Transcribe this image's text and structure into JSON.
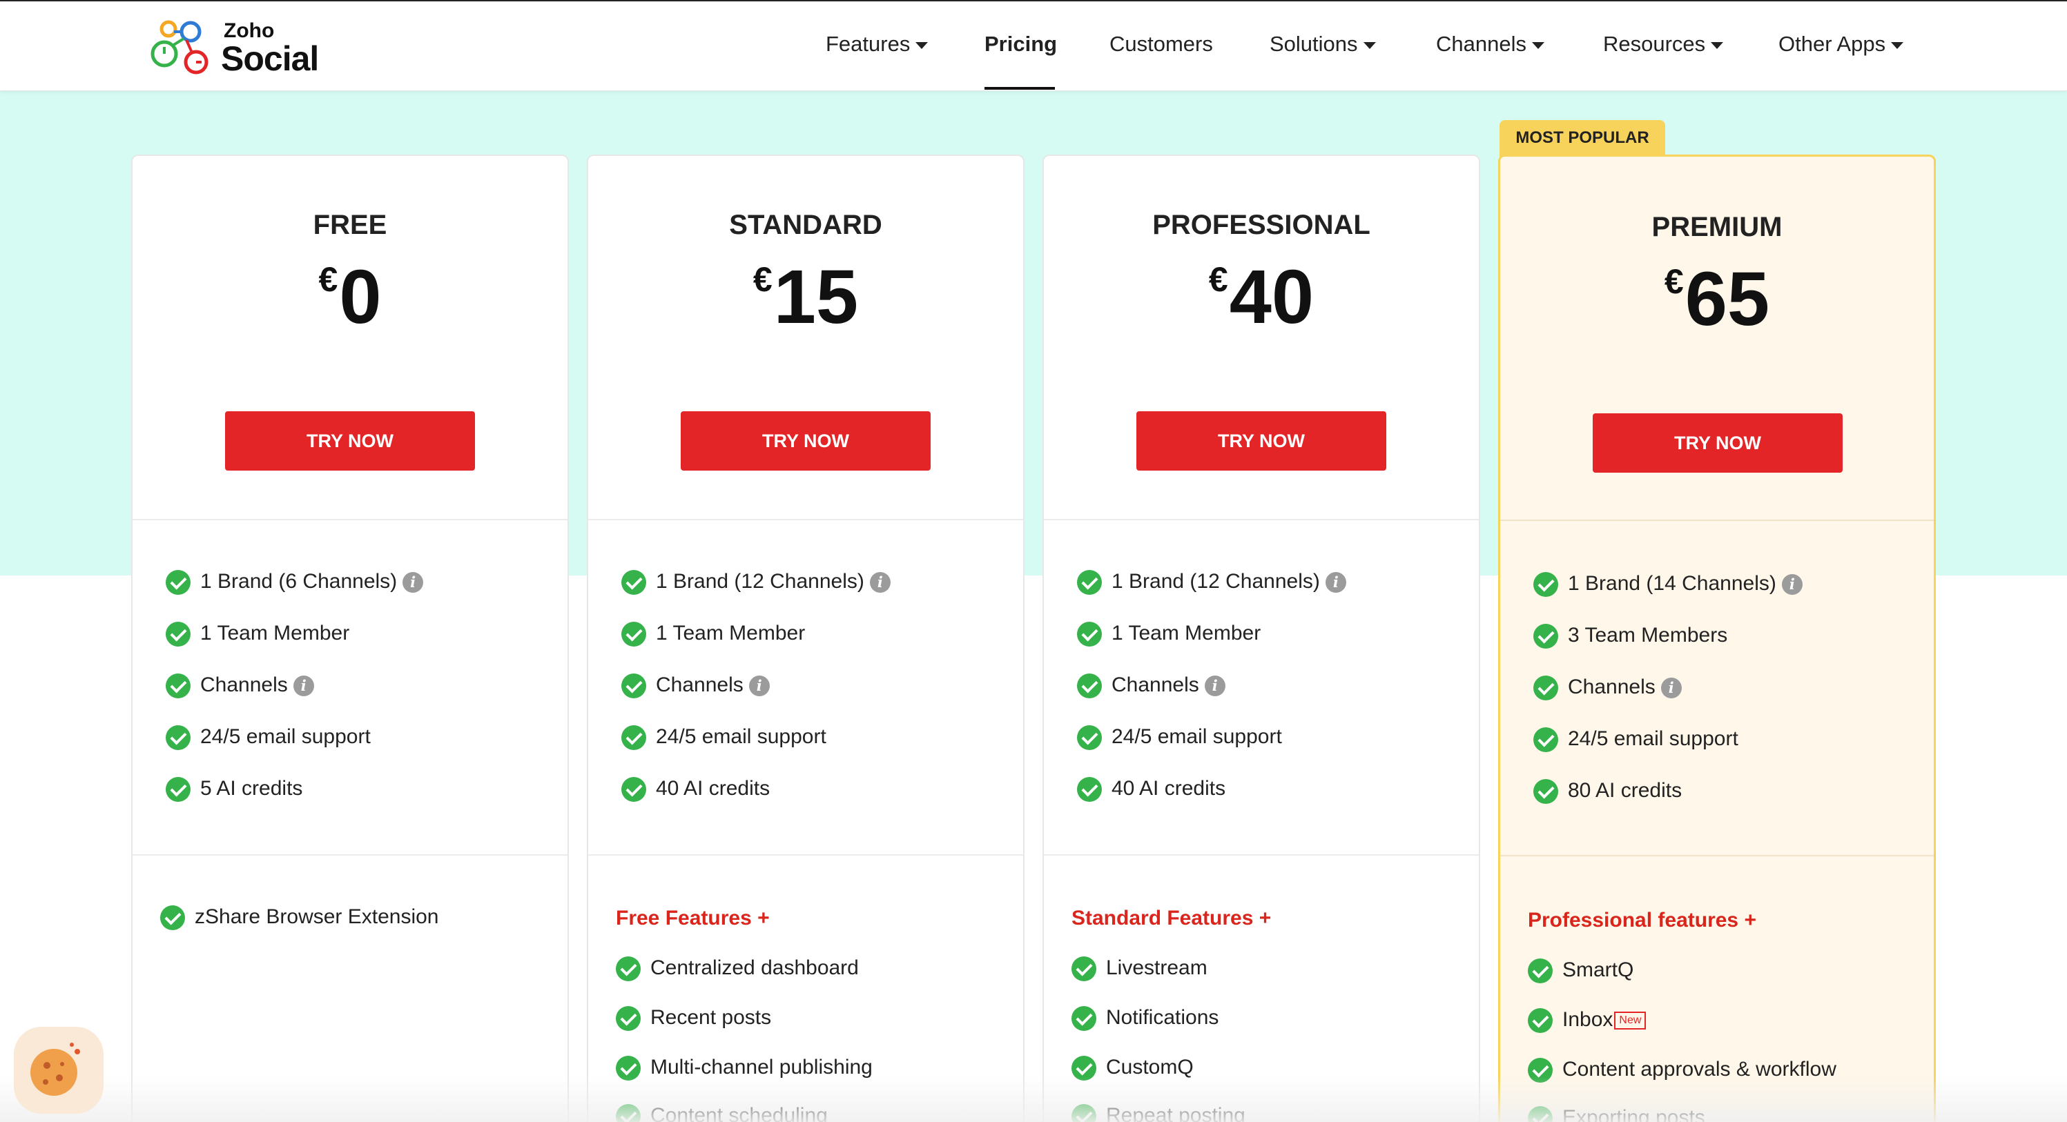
{
  "logo": {
    "top": "Zoho",
    "bottom": "Social"
  },
  "nav": {
    "items": [
      {
        "label": "Features",
        "dropdown": true
      },
      {
        "label": "Pricing",
        "dropdown": false,
        "active": true
      },
      {
        "label": "Customers",
        "dropdown": false
      },
      {
        "label": "Solutions",
        "dropdown": true
      },
      {
        "label": "Channels",
        "dropdown": true
      },
      {
        "label": "Resources",
        "dropdown": true
      },
      {
        "label": "Other Apps",
        "dropdown": true
      }
    ]
  },
  "popular_tag": "MOST POPULAR",
  "currency": "€",
  "cta": "TRY NOW",
  "new_badge": "New",
  "colors": {
    "accent": "#e42527",
    "mint": "#d6fbf3",
    "check": "#35b24a",
    "popular_bg": "#fff7e9",
    "popular_border": "#f7d35c",
    "section_red": "#d9251c"
  },
  "plans": [
    {
      "name": "FREE",
      "price": "0",
      "features": [
        "1 Brand (6 Channels)",
        "1 Team Member",
        "Channels",
        "24/5 email support",
        "5 AI credits"
      ],
      "extras_title": "",
      "extras": [
        "zShare Browser Extension"
      ]
    },
    {
      "name": "STANDARD",
      "price": "15",
      "features": [
        "1 Brand (12 Channels)",
        "1 Team Member",
        "Channels",
        "24/5 email support",
        "40 AI credits"
      ],
      "extras_title": "Free Features +",
      "extras": [
        "Centralized dashboard",
        "Recent posts",
        "Multi-channel publishing",
        "Content scheduling"
      ]
    },
    {
      "name": "PROFESSIONAL",
      "price": "40",
      "features": [
        "1 Brand (12 Channels)",
        "1 Team Member",
        "Channels",
        "24/5 email support",
        "40 AI credits"
      ],
      "extras_title": "Standard Features +",
      "extras": [
        "Livestream",
        "Notifications",
        "CustomQ",
        "Repeat posting"
      ]
    },
    {
      "name": "PREMIUM",
      "price": "65",
      "features": [
        "1 Brand (14 Channels)",
        "3 Team Members",
        "Channels",
        "24/5 email support",
        "80 AI credits"
      ],
      "extras_title": "Professional features +",
      "extras": [
        "SmartQ",
        "Inbox",
        "Content approvals & workflow",
        "Exporting posts"
      ]
    }
  ]
}
